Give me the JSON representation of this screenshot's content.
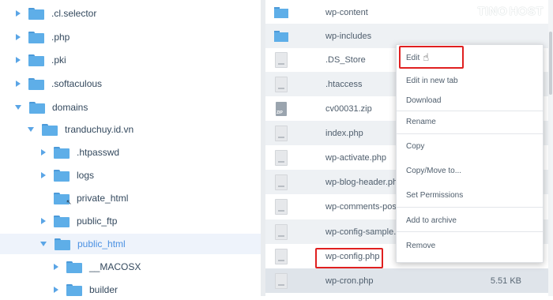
{
  "logo": {
    "text_left": "TINO",
    "text_right": "HOST"
  },
  "tree": [
    {
      "label": ".cl.selector",
      "caret": "right",
      "active": false
    },
    {
      "label": ".php",
      "caret": "right",
      "active": false
    },
    {
      "label": ".pki",
      "caret": "right",
      "active": false
    },
    {
      "label": ".softaculous",
      "caret": "right",
      "active": false
    },
    {
      "label": "domains",
      "caret": "down",
      "active": false
    },
    {
      "label": "tranduchuy.id.vn",
      "caret": "down",
      "active": false
    },
    {
      "label": ".htpasswd",
      "caret": "right",
      "active": false
    },
    {
      "label": "logs",
      "caret": "right",
      "active": false
    },
    {
      "label": "private_html",
      "caret": "none",
      "active": false
    },
    {
      "label": "public_ftp",
      "caret": "right",
      "active": false
    },
    {
      "label": "public_html",
      "caret": "down",
      "active": true
    },
    {
      "label": "__MACOSX",
      "caret": "right",
      "active": false
    },
    {
      "label": "builder",
      "caret": "right",
      "active": false
    }
  ],
  "files": [
    {
      "name": "wp-content",
      "type": "folder",
      "size": ""
    },
    {
      "name": "wp-includes",
      "type": "folder",
      "size": ""
    },
    {
      "name": ".DS_Store",
      "type": "file",
      "size": ""
    },
    {
      "name": ".htaccess",
      "type": "file",
      "size": ""
    },
    {
      "name": "cv00031.zip",
      "type": "zip",
      "size": ""
    },
    {
      "name": "index.php",
      "type": "file",
      "size": ""
    },
    {
      "name": "wp-activate.php",
      "type": "file",
      "size": ""
    },
    {
      "name": "wp-blog-header.php",
      "type": "file",
      "size": ""
    },
    {
      "name": "wp-comments-post.p",
      "type": "file",
      "size": ""
    },
    {
      "name": "wp-config-sample.php",
      "type": "file",
      "size": ""
    },
    {
      "name": "wp-config.php",
      "type": "file",
      "size": ""
    },
    {
      "name": "wp-cron.php",
      "type": "file",
      "size": "5.51 KB"
    }
  ],
  "menu": [
    {
      "label": "Edit"
    },
    {
      "label": "Edit in new tab"
    },
    {
      "label": "Download"
    },
    {
      "label": "Rename"
    },
    {
      "label": "Copy"
    },
    {
      "label": "Copy/Move to..."
    },
    {
      "label": "Set Permissions"
    },
    {
      "label": "Add to archive"
    },
    {
      "label": "Remove"
    }
  ],
  "colors": {
    "highlight": "#e02020",
    "folder": "#5eaee8",
    "active_text": "#4a90e2"
  }
}
